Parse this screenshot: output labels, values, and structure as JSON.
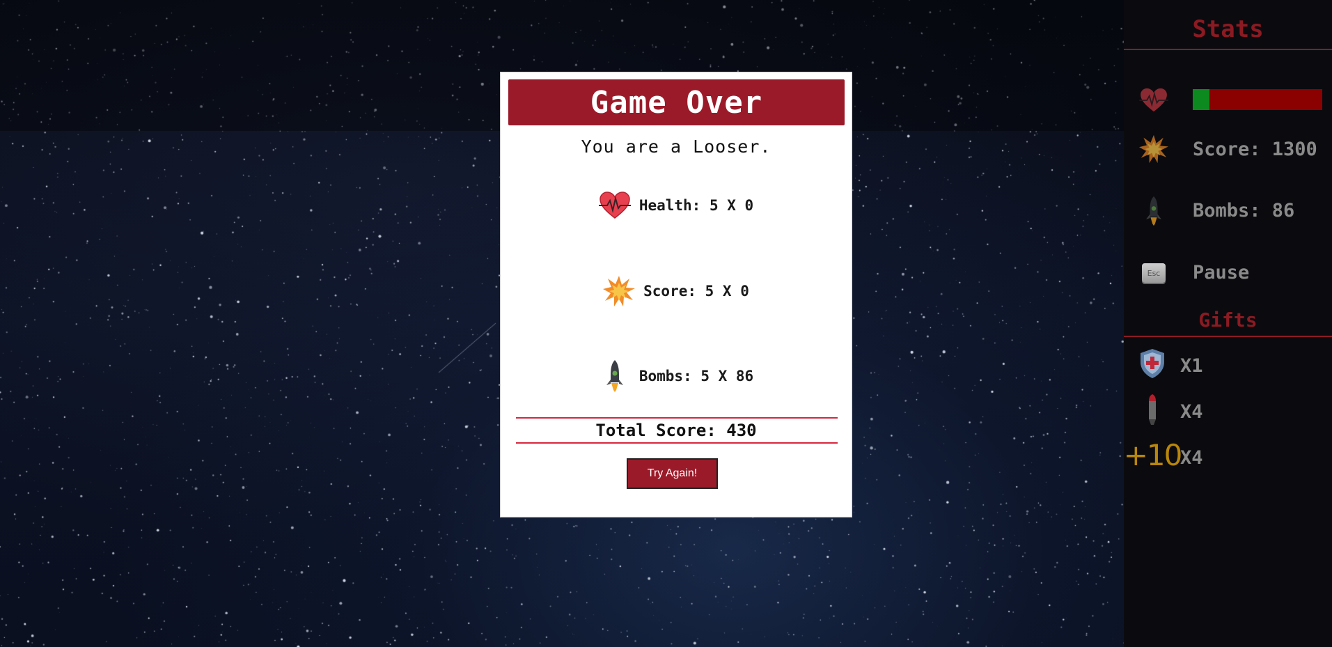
{
  "modal": {
    "title": "Game Over",
    "subtitle": "You are a Looser.",
    "health_line": "Health: 5 X 0",
    "score_line": "Score: 5 X 0",
    "bombs_line": "Bombs: 5 X 86",
    "total": "Total Score: 430",
    "try_again": "Try Again!"
  },
  "sidebar": {
    "stats_title": "Stats",
    "health_fraction": 0.13,
    "score": "Score: 1300",
    "bombs": "Bombs: 86",
    "pause": "Pause",
    "esc_key": "Esc",
    "gifts_title": "Gifts",
    "gifts": [
      {
        "icon": "health-shield-icon",
        "count": "X1"
      },
      {
        "icon": "red-bomb-icon",
        "count": "X4"
      },
      {
        "icon": "plus-ten-icon",
        "label": "+10",
        "count": "X4"
      }
    ]
  },
  "colors": {
    "accent": "#9b1a29",
    "sidebar_title": "#8c1a22",
    "health_fill": "#0d8a1f",
    "health_empty": "#8b0000",
    "rule": "#d7263d"
  }
}
